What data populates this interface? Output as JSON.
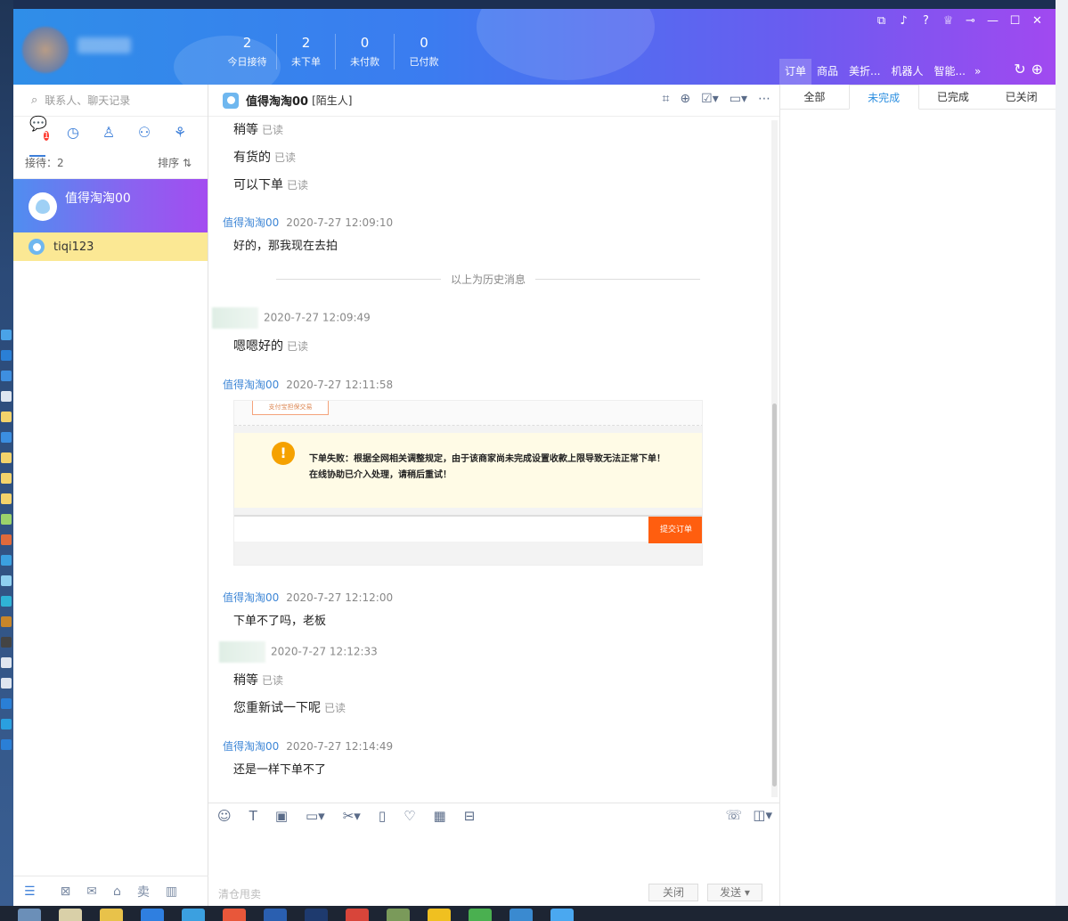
{
  "stats": [
    {
      "num": "2",
      "label": "今日接待"
    },
    {
      "num": "2",
      "label": "未下单"
    },
    {
      "num": "0",
      "label": "未付款"
    },
    {
      "num": "0",
      "label": "已付款"
    }
  ],
  "right_tabs": [
    "订单",
    "商品",
    "美折...",
    "机器人",
    "智能..."
  ],
  "order_tabs": [
    "全部",
    "未完成",
    "已完成",
    "已关闭"
  ],
  "search": {
    "placeholder": "联系人、聊天记录"
  },
  "nav": {
    "badge": "1"
  },
  "reception": {
    "label": "接待：2",
    "sort": "排序 ⇅"
  },
  "contacts": [
    {
      "name": "值得淘淘00"
    },
    {
      "name": "tiqi123"
    }
  ],
  "chat": {
    "title": "值得淘淘00",
    "subtitle": "[陌生人]",
    "read": "已读",
    "history_label": "以上为历史消息",
    "messages": {
      "m1": "稍等",
      "m2": "有货的",
      "m3": "可以下单",
      "meta1_who": "值得淘淘00",
      "meta1_time": "2020-7-27 12:09:10",
      "m4": "好的，那我现在去拍",
      "meta2_time": "2020-7-27 12:09:49",
      "m5": "嗯嗯好的",
      "meta3_who": "值得淘淘00",
      "meta3_time": "2020-7-27 12:11:58",
      "meta4_who": "值得淘淘00",
      "meta4_time": "2020-7-27 12:12:00",
      "m6": "下单不了吗，老板",
      "meta5_time": "2020-7-27 12:12:33",
      "m7": "稍等",
      "m8": "您重新试一下呢",
      "meta6_who": "值得淘淘00",
      "meta6_time": "2020-7-27 12:14:49",
      "m9": "还是一样下单不了"
    },
    "screenshot": {
      "tab": "支付宝担保交易",
      "warn_line1": "下单失败：根据全网相关调整规定，由于该商家尚未完成设置收款上限导致无法正常下单！",
      "warn_line2": "在线协助已介入处理，请稍后重试！",
      "submit": "提交订单"
    }
  },
  "input": {
    "hint": "清仓甩卖",
    "close": "关闭",
    "send": "发送 ▾"
  }
}
